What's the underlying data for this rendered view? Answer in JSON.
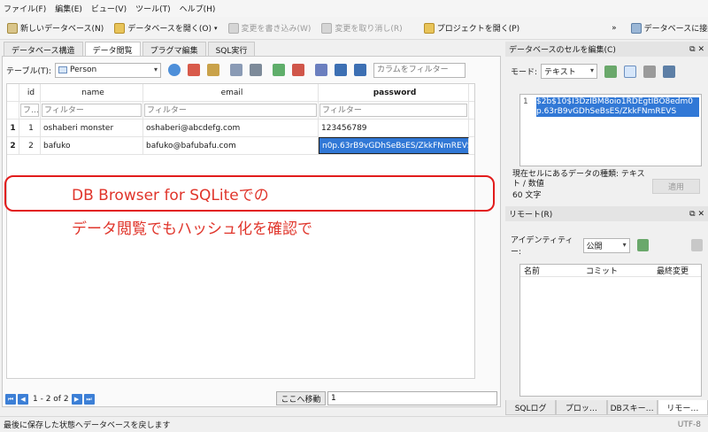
{
  "menubar": [
    "ファイル(F)",
    "編集(E)",
    "ビュー(V)",
    "ツール(T)",
    "ヘルプ(H)"
  ],
  "toolbar": {
    "new_db": "新しいデータベース(N)",
    "open_db": "データベースを開く(O)",
    "write_changes": "変更を書き込み(W)",
    "revert_changes": "変更を取り消し(R)",
    "open_project": "プロジェクトを開く(P)",
    "more": "»",
    "connect_db": "データベースに接続(A)"
  },
  "tabs": [
    "データベース構造",
    "データ閲覧",
    "プラグマ編集",
    "SQL実行"
  ],
  "browse": {
    "table_label": "テーブル(T):",
    "table_value": "Person",
    "filter_all_placeholder": "カラムをフィルター",
    "columns": [
      "id",
      "name",
      "email",
      "password"
    ],
    "filter_first": "フ…",
    "filter_placeholder": "フィルター",
    "rows": [
      {
        "rownum": "1",
        "id": "1",
        "name": "oshaberi monster",
        "email": "oshaberi@abcdefg.com",
        "password": "123456789"
      },
      {
        "rownum": "2",
        "id": "2",
        "name": "bafuko",
        "email": "bafuko@bafubafu.com",
        "password": "n0p.63rB9vGDhSeBsES/ZkkFNmREVS"
      }
    ]
  },
  "annotation": {
    "line1": "DB Browser for SQLiteでの",
    "line2": "データ閲覧でもハッシュ化を確認で"
  },
  "pager": {
    "text": "1 - 2 of 2",
    "goto_label": "ここへ移動",
    "goto_value": "1"
  },
  "status": {
    "text": "最後に保存した状態へデータベースを戻します",
    "encoding": "UTF-8"
  },
  "edit_cell": {
    "title": "データベースのセルを編集(C)",
    "mode_label": "モード:",
    "mode_value": "テキスト",
    "line_no": "1",
    "value": "$2b$10$I3DzIBM8oio1RDEgtIBO8edm0p.63rB9vGDhSeBsES/ZkkFNmREVS",
    "type_info": "現在セルにあるデータの種類: テキスト / 数値",
    "size_info": "60 文字",
    "apply": "適用"
  },
  "remote": {
    "title": "リモート(R)",
    "identity_label": "アイデンティティー:",
    "identity_value": "公開",
    "columns": [
      "名前",
      "コミット",
      "最終変更"
    ]
  },
  "bottom_tabs": [
    "SQLログ",
    "プロッ…",
    "DBスキー…",
    "リモー…"
  ],
  "panel_controls": "⧉ ✕",
  "colors": {
    "accent": "#3178d6",
    "annotation": "#e0352b"
  }
}
